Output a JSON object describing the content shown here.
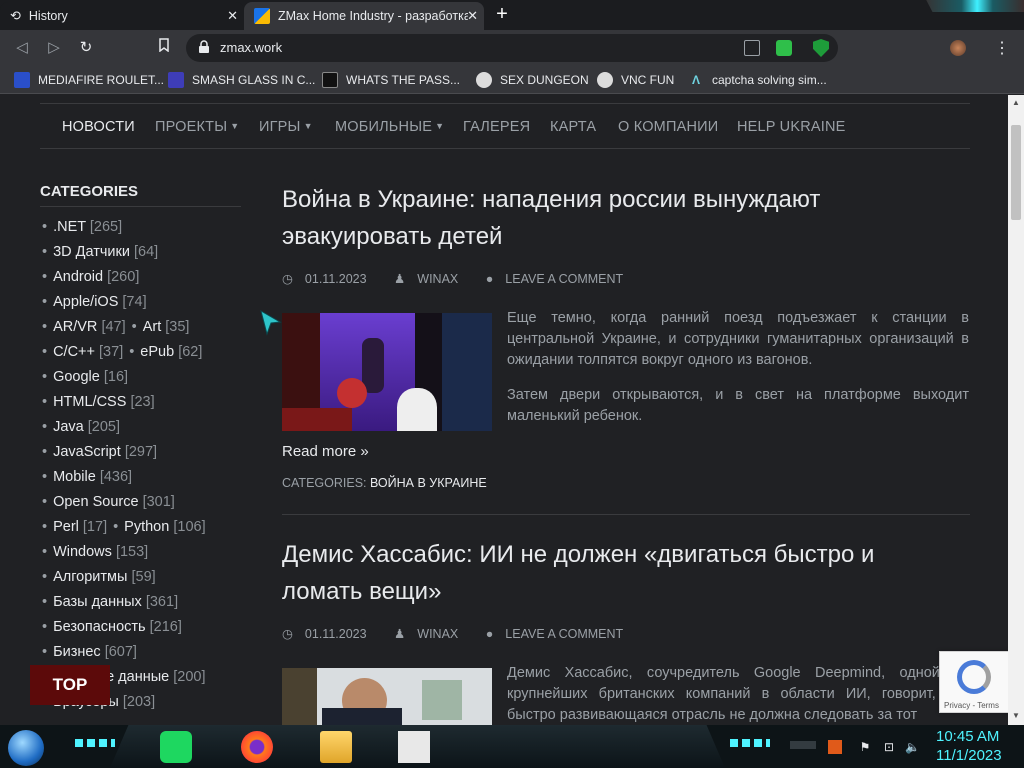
{
  "tabs": [
    {
      "label": "History",
      "active": false
    },
    {
      "label": "ZMax Home Industry - разработка",
      "active": true
    }
  ],
  "address_bar": {
    "url": "zmax.work"
  },
  "bookmarks": [
    {
      "label": "MEDIAFIRE ROULET..."
    },
    {
      "label": "SMASH GLASS IN C..."
    },
    {
      "label": "WHATS THE PASS..."
    },
    {
      "label": "SEX DUNGEON"
    },
    {
      "label": "VNC FUN"
    },
    {
      "label": "captcha solving sim..."
    }
  ],
  "nav": [
    {
      "label": "НОВОСТИ",
      "active": true
    },
    {
      "label": "ПРОЕКТЫ",
      "dropdown": true
    },
    {
      "label": "ИГРЫ",
      "dropdown": true
    },
    {
      "label": "МОБИЛЬНЫЕ",
      "dropdown": true
    },
    {
      "label": "ГАЛЕРЕЯ"
    },
    {
      "label": "КАРТА"
    },
    {
      "label": "О КОМПАНИИ"
    },
    {
      "label": "HELP UKRAINE"
    }
  ],
  "sidebar": {
    "title": "CATEGORIES",
    "categories": [
      [
        {
          "name": ".NET",
          "count": "[265]"
        }
      ],
      [
        {
          "name": "3D Датчики",
          "count": "[64]"
        }
      ],
      [
        {
          "name": "Android",
          "count": "[260]"
        }
      ],
      [
        {
          "name": "Apple/iOS",
          "count": "[74]"
        }
      ],
      [
        {
          "name": "AR/VR",
          "count": "[47]"
        },
        {
          "name": "Art",
          "count": "[35]"
        }
      ],
      [
        {
          "name": "C/C++",
          "count": "[37]"
        },
        {
          "name": "ePub",
          "count": "[62]"
        }
      ],
      [
        {
          "name": "Google",
          "count": "[16]"
        }
      ],
      [
        {
          "name": "HTML/CSS",
          "count": "[23]"
        }
      ],
      [
        {
          "name": "Java",
          "count": "[205]"
        }
      ],
      [
        {
          "name": "JavaScript",
          "count": "[297]"
        }
      ],
      [
        {
          "name": "Mobile",
          "count": "[436]"
        }
      ],
      [
        {
          "name": "Open Source",
          "count": "[301]"
        }
      ],
      [
        {
          "name": "Perl",
          "count": "[17]"
        },
        {
          "name": "Python",
          "count": "[106]"
        }
      ],
      [
        {
          "name": "Windows",
          "count": "[153]"
        }
      ],
      [
        {
          "name": "Алгоритмы",
          "count": "[59]"
        }
      ],
      [
        {
          "name": "Базы данных",
          "count": "[361]"
        }
      ],
      [
        {
          "name": "Безопасность",
          "count": "[216]"
        }
      ],
      [
        {
          "name": "Бизнес",
          "count": "[607]"
        }
      ],
      [
        {
          "name": "Большие данные",
          "count": "[200]"
        }
      ],
      [
        {
          "name": "Браузеры",
          "count": "[203]"
        }
      ]
    ]
  },
  "posts": [
    {
      "title": "Война в Украине: нападения россии вынуждают эвакуировать детей",
      "date": "01.11.2023",
      "author": "WINAX",
      "comment": "LEAVE A COMMENT",
      "paragraphs": [
        "Еще темно, когда ранний поезд подъезжает к станции в центральной Украине, и сотрудники гуманитарных организаций в ожидании толпятся вокруг одного из вагонов.",
        "Затем двери открываются, и в свет на платформе выходит маленький ребенок."
      ],
      "read_more": "Read more »",
      "categories_label": "CATEGORIES:",
      "category": "ВОЙНА В УКРАИНЕ"
    },
    {
      "title": "Демис Хассабис: ИИ не должен «двигаться быстро и ломать вещи»",
      "date": "01.11.2023",
      "author": "WINAX",
      "comment": "LEAVE A COMMENT",
      "paragraphs": [
        "Демис Хассабис, соучредитель Google Deepmind, одной из крупнейших британских компаний в области ИИ, говорит, что быстро развивающаяся отрасль не должна следовать за тот"
      ]
    }
  ],
  "top_button": "TOP",
  "recaptcha": {
    "label": "Privacy - Terms"
  },
  "taskbar": {
    "time": "10:45 AM",
    "date": "11/1/2023"
  }
}
